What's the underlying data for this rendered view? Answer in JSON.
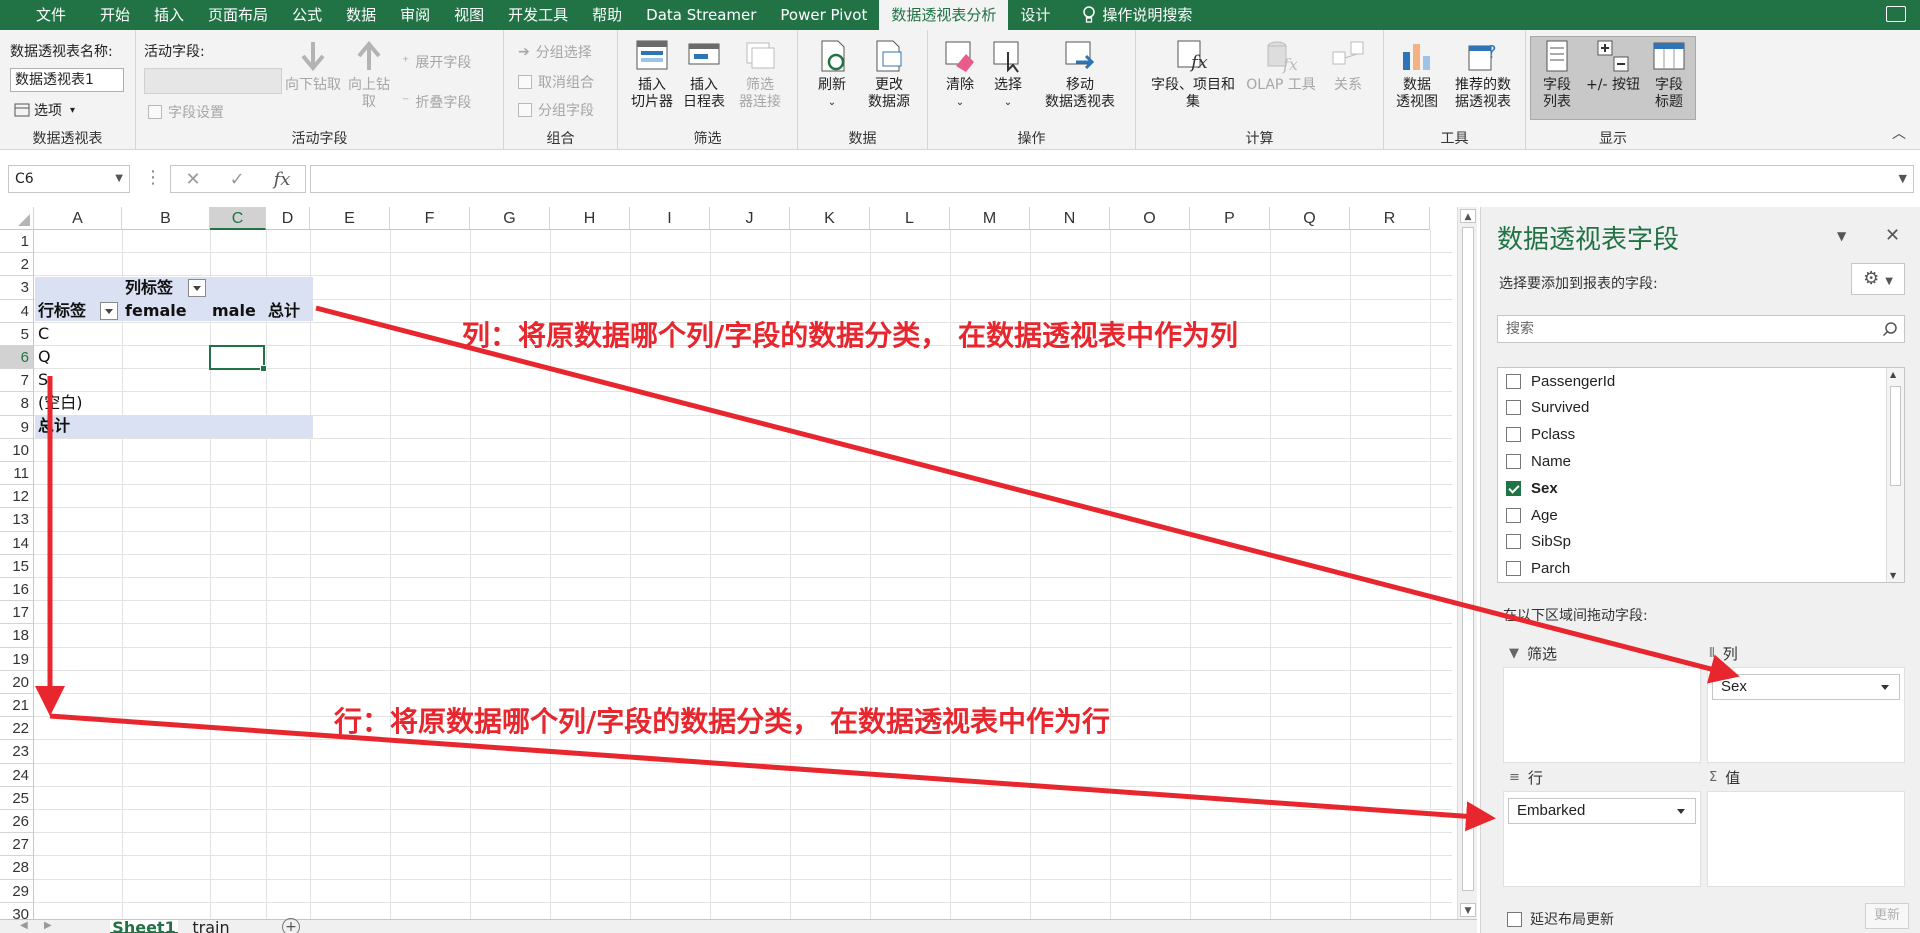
{
  "menu": {
    "tabs": [
      "文件",
      "开始",
      "插入",
      "页面布局",
      "公式",
      "数据",
      "审阅",
      "视图",
      "开发工具",
      "帮助",
      "Data Streamer",
      "Power Pivot",
      "数据透视表分析",
      "设计"
    ],
    "search": "操作说明搜索"
  },
  "ribbon": {
    "pt_group": {
      "name_label": "数据透视表名称:",
      "name_value": "数据透视表1",
      "options": "选项",
      "label": "数据透视表"
    },
    "active_group": {
      "field_label": "活动字段:",
      "field_settings": "字段设置",
      "drill_down": "向下钻取",
      "drill_up": "向上钻",
      "drill_up2": "取",
      "expand": "展开字段",
      "collapse": "折叠字段",
      "label": "活动字段"
    },
    "group_group": {
      "group_sel": "分组选择",
      "ungroup": "取消组合",
      "group_field": "分组字段",
      "label": "组合"
    },
    "filter_group": {
      "slicer": "插入",
      "slicer2": "切片器",
      "timeline": "插入",
      "timeline2": "日程表",
      "conn": "筛选",
      "conn2": "器连接",
      "label": "筛选"
    },
    "data_group": {
      "refresh": "刷新",
      "change": "更改",
      "change2": "数据源",
      "label": "数据"
    },
    "ops_group": {
      "clear": "清除",
      "select": "选择",
      "move": "移动",
      "move2": "数据透视表",
      "label": "操作"
    },
    "calc_group": {
      "fields": "字段、项目和",
      "fields2": "集",
      "olap": "OLAP 工具",
      "rel": "关系",
      "label": "计算"
    },
    "tools_group": {
      "chart": "数据",
      "chart2": "透视图",
      "rec": "推荐的数",
      "rec2": "据透视表",
      "label": "工具"
    },
    "show_group": {
      "list": "字段",
      "list2": "列表",
      "btns": "+/- 按钮",
      "headers": "字段",
      "headers2": "标题",
      "label": "显示"
    }
  },
  "formula": {
    "namebox": "C6",
    "cancel": "✕",
    "enter": "✓",
    "fx": "fx",
    "value": ""
  },
  "grid": {
    "columns": [
      "A",
      "B",
      "C",
      "D",
      "E",
      "F",
      "G",
      "H",
      "I",
      "J",
      "K",
      "L",
      "M",
      "N",
      "O",
      "P",
      "Q",
      "R"
    ],
    "selected_col": "C",
    "selected_row": "6",
    "rows": [
      "1",
      "2",
      "3",
      "4",
      "5",
      "6",
      "7",
      "8",
      "9",
      "10",
      "11",
      "12",
      "13",
      "14",
      "15",
      "16",
      "17",
      "18",
      "19",
      "20",
      "21",
      "22",
      "23",
      "24",
      "25",
      "26",
      "27",
      "28",
      "29",
      "30"
    ],
    "pivot": {
      "col_labels": "列标签",
      "row_labels": "行标签",
      "headers": [
        "female",
        "male",
        "总计"
      ],
      "row_items": [
        "C",
        "Q",
        "S",
        "(空白)"
      ],
      "total": "总计"
    }
  },
  "sheets": [
    "Sheet1",
    "train"
  ],
  "pane": {
    "title": "数据透视表字段",
    "subtitle": "选择要添加到报表的字段:",
    "search_placeholder": "搜索",
    "fields": [
      {
        "name": "PassengerId",
        "checked": false
      },
      {
        "name": "Survived",
        "checked": false
      },
      {
        "name": "Pclass",
        "checked": false
      },
      {
        "name": "Name",
        "checked": false
      },
      {
        "name": "Sex",
        "checked": true
      },
      {
        "name": "Age",
        "checked": false
      },
      {
        "name": "SibSp",
        "checked": false
      },
      {
        "name": "Parch",
        "checked": false
      }
    ],
    "drag_text": "在以下区域间拖动字段:",
    "areas": {
      "filter": "筛选",
      "columns": "列",
      "rows": "行",
      "values": "值"
    },
    "col_field": "Sex",
    "row_field": "Embarked",
    "defer": "延迟布局更新",
    "update": "更新"
  },
  "annotations": {
    "col_note": "列：将原数据哪个列/字段的数据分类， 在数据透视表中作为列",
    "row_note": "行：将原数据哪个列/字段的数据分类， 在数据透视表中作为行"
  },
  "colors": {
    "excel_green": "#217346",
    "pivot_band": "#d9e1f2",
    "annotation_red": "#e8262d"
  }
}
